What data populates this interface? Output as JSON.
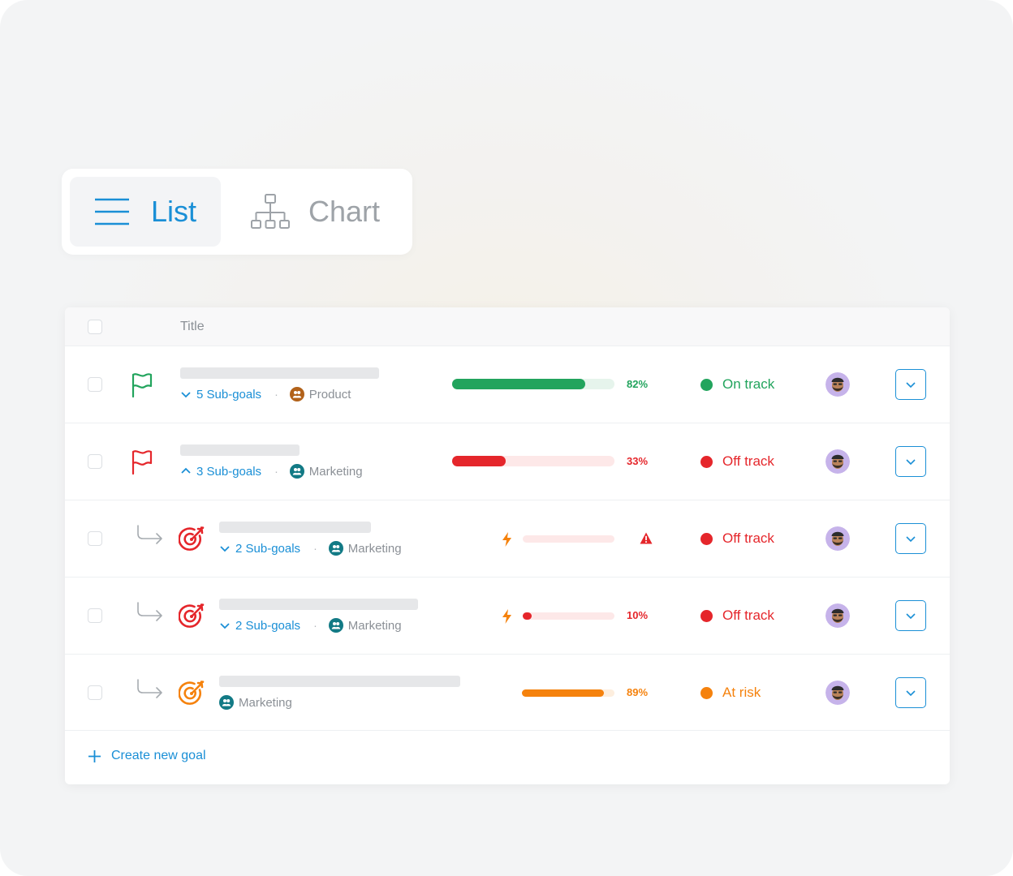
{
  "view_switch": {
    "list_label": "List",
    "chart_label": "Chart",
    "active": "List"
  },
  "table": {
    "header_title": "Title",
    "rows": [
      {
        "subgoals_label": "5 Sub-goals",
        "subgoals_expanded": false,
        "team": "Product",
        "team_color": "#b2621a",
        "progress_pct": 82,
        "progress_label": "82%",
        "progress_color": "#22a45d",
        "status": "On track",
        "status_color": "#22a45d",
        "icon": "green-flag-icon"
      },
      {
        "subgoals_label": "3 Sub-goals",
        "subgoals_expanded": true,
        "team": "Marketing",
        "team_color": "#127a85",
        "progress_pct": 33,
        "progress_label": "33%",
        "progress_color": "#e5262b",
        "status": "Off track",
        "status_color": "#e5262b",
        "icon": "red-flag-icon"
      },
      {
        "subgoals_label": "2 Sub-goals",
        "subgoals_expanded": false,
        "team": "Marketing",
        "team_color": "#127a85",
        "progress_pct": 0,
        "progress_label": "",
        "progress_color": "#e5262b",
        "status": "Off track",
        "status_color": "#e5262b",
        "icon": "red-target-icon",
        "warning": true
      },
      {
        "subgoals_label": "2 Sub-goals",
        "subgoals_expanded": false,
        "team": "Marketing",
        "team_color": "#127a85",
        "progress_pct": 10,
        "progress_label": "10%",
        "progress_color": "#e5262b",
        "status": "Off track",
        "status_color": "#e5262b",
        "icon": "red-target-icon"
      },
      {
        "subgoals_label": "",
        "team": "Marketing",
        "team_color": "#127a85",
        "progress_pct": 89,
        "progress_label": "89%",
        "progress_color": "#f5820d",
        "status": "At risk",
        "status_color": "#f5820d",
        "icon": "orange-target-icon"
      }
    ],
    "create_label": "Create new goal"
  }
}
